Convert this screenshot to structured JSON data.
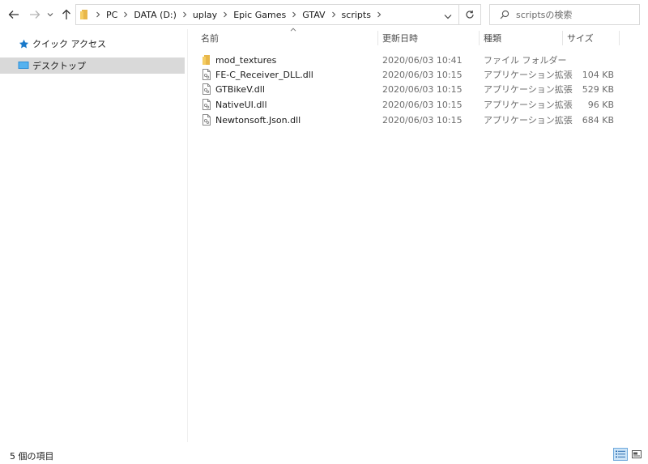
{
  "address": {
    "breadcrumbs": [
      "PC",
      "DATA (D:)",
      "uplay",
      "Epic Games",
      "GTAV",
      "scripts"
    ]
  },
  "search": {
    "placeholder": "scriptsの検索"
  },
  "navpane": {
    "items": [
      {
        "label": "クイック アクセス",
        "icon": "star-icon",
        "selected": false
      },
      {
        "label": "デスクトップ",
        "icon": "desktop-icon",
        "selected": true
      }
    ]
  },
  "columns": {
    "name": "名前",
    "date": "更新日時",
    "type": "種類",
    "size": "サイズ"
  },
  "files": [
    {
      "name": "mod_textures",
      "date": "2020/06/03 10:41",
      "type": "ファイル フォルダー",
      "size": "",
      "icon": "folder-icon"
    },
    {
      "name": "FE-C_Receiver_DLL.dll",
      "date": "2020/06/03 10:15",
      "type": "アプリケーション拡張",
      "size": "104 KB",
      "icon": "dll-file-icon"
    },
    {
      "name": "GTBikeV.dll",
      "date": "2020/06/03 10:15",
      "type": "アプリケーション拡張",
      "size": "529 KB",
      "icon": "dll-file-icon"
    },
    {
      "name": "NativeUI.dll",
      "date": "2020/06/03 10:15",
      "type": "アプリケーション拡張",
      "size": "96 KB",
      "icon": "dll-file-icon"
    },
    {
      "name": "Newtonsoft.Json.dll",
      "date": "2020/06/03 10:15",
      "type": "アプリケーション拡張",
      "size": "684 KB",
      "icon": "dll-file-icon"
    }
  ],
  "status": {
    "item_count": "5 個の項目"
  },
  "colors": {
    "folder": "#e8b74a",
    "accent": "#1979ca",
    "selection": "#d9d9d9"
  }
}
